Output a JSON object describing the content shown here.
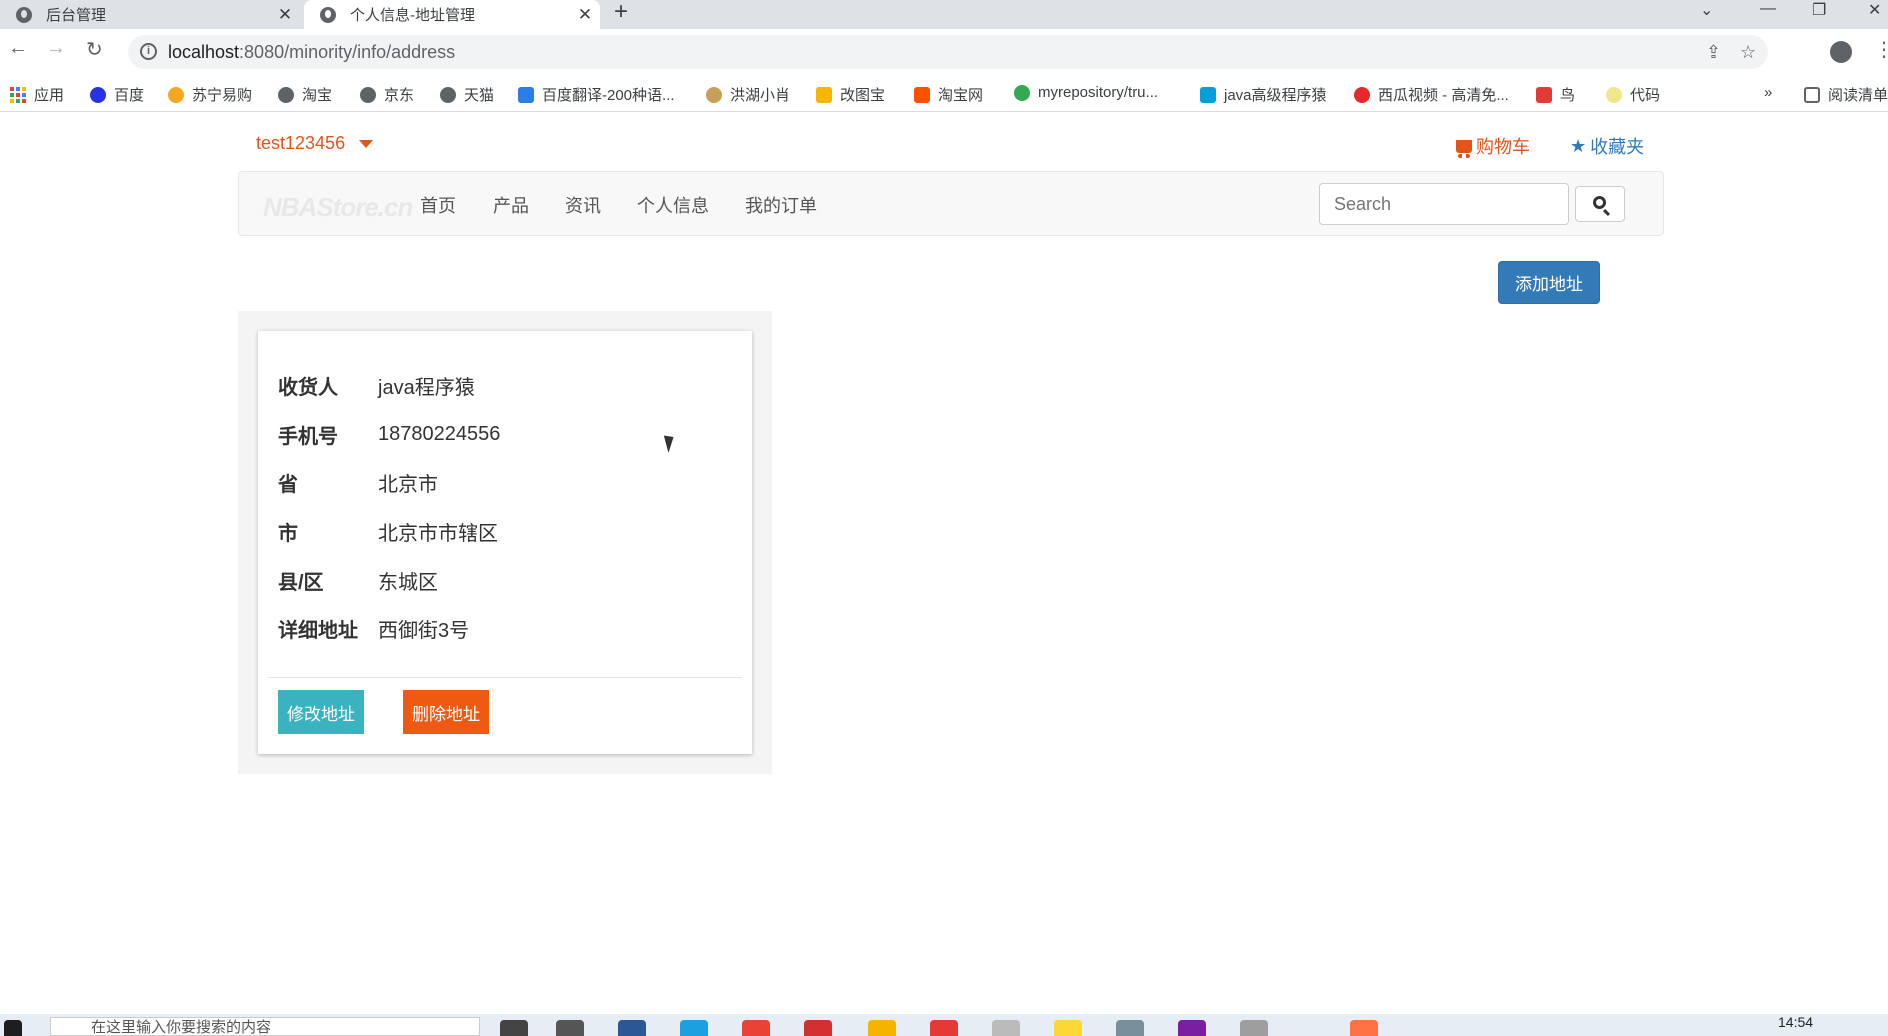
{
  "browser": {
    "tabs": [
      {
        "title": "后台管理",
        "close": "✕"
      },
      {
        "title": "个人信息-地址管理",
        "close": "✕"
      }
    ],
    "new_tab": "+",
    "window_controls": {
      "minimize": "—",
      "maximize": "❐",
      "close": "✕"
    },
    "nav": {
      "back": "←",
      "forward": "→",
      "reload": "↻"
    },
    "url_host": "localhost",
    "url_rest": ":8080/minority/info/address",
    "bookmarks": [
      "应用",
      "百度",
      "苏宁易购",
      "淘宝",
      "京东",
      "天猫",
      "百度翻译-200种语...",
      "洪湖小肖",
      "改图宝",
      "淘宝网",
      "myrepository/tru...",
      "java高级程序猿",
      "西瓜视频 - 高清免...",
      "鸟",
      "代码"
    ],
    "more_bookmarks": "»",
    "reading_list": "阅读清单"
  },
  "header": {
    "username": "test123456",
    "cart": "购物车",
    "favorites": "收藏夹"
  },
  "navbar": {
    "brand": "NBAStore.cn",
    "items": [
      "首页",
      "产品",
      "资讯",
      "个人信息",
      "我的订单"
    ],
    "search_placeholder": "Search"
  },
  "actions": {
    "add_address": "添加地址"
  },
  "address_card": {
    "fields": [
      {
        "label": "收货人",
        "value": "java程序猿"
      },
      {
        "label": "手机号",
        "value": "18780224556"
      },
      {
        "label": "省",
        "value": "北京市"
      },
      {
        "label": "市",
        "value": "北京市市辖区"
      },
      {
        "label": "县/区",
        "value": "东城区"
      },
      {
        "label": "详细地址",
        "value": "西御街3号"
      }
    ],
    "edit_button": "修改地址",
    "delete_button": "删除地址"
  },
  "taskbar": {
    "search_placeholder": "在这里输入你要搜索的内容",
    "time": "14:54"
  },
  "colors": {
    "accent_orange": "#e4531c",
    "link_blue": "#337ab7",
    "edit_teal": "#3bb2bf",
    "delete_orange": "#ef5a13"
  }
}
